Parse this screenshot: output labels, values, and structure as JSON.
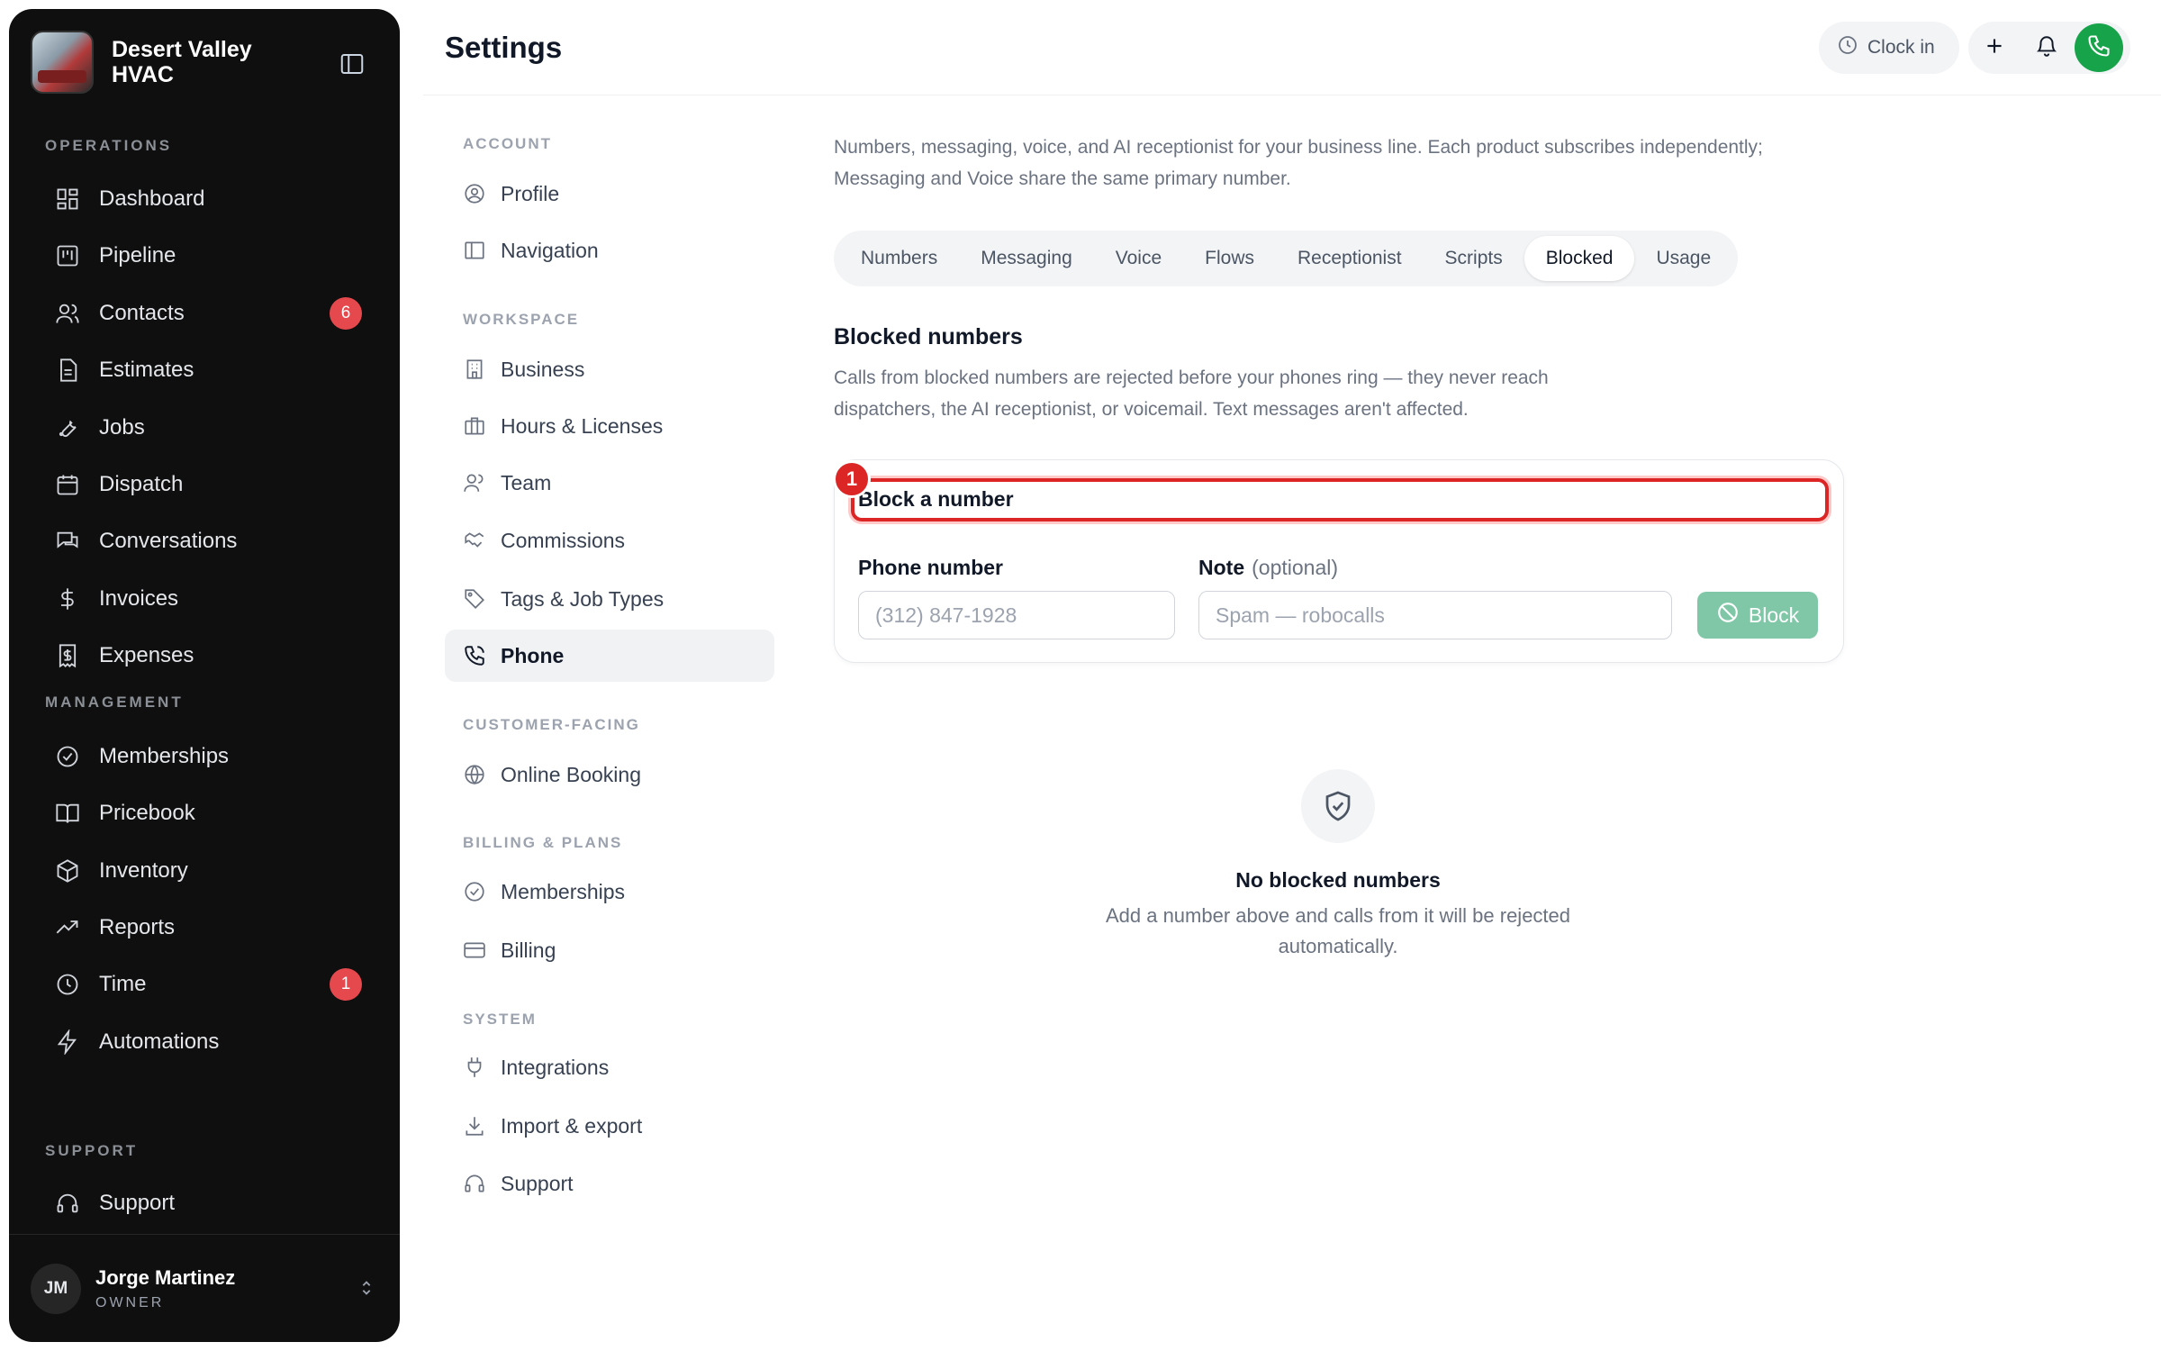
{
  "brand": {
    "name": "Desert Valley HVAC"
  },
  "sidebar": {
    "sections": {
      "operations": "OPERATIONS",
      "management": "MANAGEMENT",
      "support": "SUPPORT"
    },
    "items": [
      {
        "label": "Dashboard",
        "icon": "dashboard-icon"
      },
      {
        "label": "Pipeline",
        "icon": "pipeline-icon"
      },
      {
        "label": "Contacts",
        "icon": "contacts-icon",
        "badge": "6"
      },
      {
        "label": "Estimates",
        "icon": "estimates-icon"
      },
      {
        "label": "Jobs",
        "icon": "wrench-icon"
      },
      {
        "label": "Dispatch",
        "icon": "calendar-icon"
      },
      {
        "label": "Conversations",
        "icon": "chat-icon"
      },
      {
        "label": "Invoices",
        "icon": "dollar-icon"
      },
      {
        "label": "Expenses",
        "icon": "receipt-icon"
      },
      {
        "label": "Memberships",
        "icon": "check-circle-icon"
      },
      {
        "label": "Pricebook",
        "icon": "book-icon"
      },
      {
        "label": "Inventory",
        "icon": "box-icon"
      },
      {
        "label": "Reports",
        "icon": "trend-icon"
      },
      {
        "label": "Time",
        "icon": "clock-icon",
        "badge": "1"
      },
      {
        "label": "Automations",
        "icon": "bolt-icon"
      },
      {
        "label": "Support",
        "icon": "headset-icon"
      }
    ],
    "user": {
      "initials": "JM",
      "name": "Jorge Martinez",
      "role": "OWNER"
    }
  },
  "header": {
    "title": "Settings",
    "clock_in": "Clock in"
  },
  "settings_nav": {
    "sections": {
      "account": "ACCOUNT",
      "workspace": "WORKSPACE",
      "customer": "CUSTOMER-FACING",
      "billing": "BILLING & PLANS",
      "system": "SYSTEM"
    },
    "items": [
      {
        "label": "Profile"
      },
      {
        "label": "Navigation"
      },
      {
        "label": "Business"
      },
      {
        "label": "Hours & Licenses"
      },
      {
        "label": "Team"
      },
      {
        "label": "Commissions"
      },
      {
        "label": "Tags & Job Types"
      },
      {
        "label": "Phone",
        "active": true
      },
      {
        "label": "Online Booking"
      },
      {
        "label": "Memberships"
      },
      {
        "label": "Billing"
      },
      {
        "label": "Integrations"
      },
      {
        "label": "Import & export"
      },
      {
        "label": "Support"
      }
    ]
  },
  "content": {
    "intro": "Numbers, messaging, voice, and AI receptionist for your business line. Each product subscribes independently; Messaging and Voice share the same primary number.",
    "tabs": [
      "Numbers",
      "Messaging",
      "Voice",
      "Flows",
      "Receptionist",
      "Scripts",
      "Blocked",
      "Usage"
    ],
    "active_tab": "Blocked",
    "blocked": {
      "title": "Blocked numbers",
      "description": "Calls from blocked numbers are rejected before your phones ring — they never reach dispatchers, the AI receptionist, or voicemail. Text messages aren't affected.",
      "card_title": "Block a number",
      "marker": "1",
      "phone_label": "Phone number",
      "phone_placeholder": "(312) 847-1928",
      "note_label": "Note",
      "note_optional": "(optional)",
      "note_placeholder": "Spam — robocalls",
      "block_button": "Block",
      "empty_title": "No blocked numbers",
      "empty_desc": "Add a number above and calls from it will be rejected automatically."
    }
  }
}
